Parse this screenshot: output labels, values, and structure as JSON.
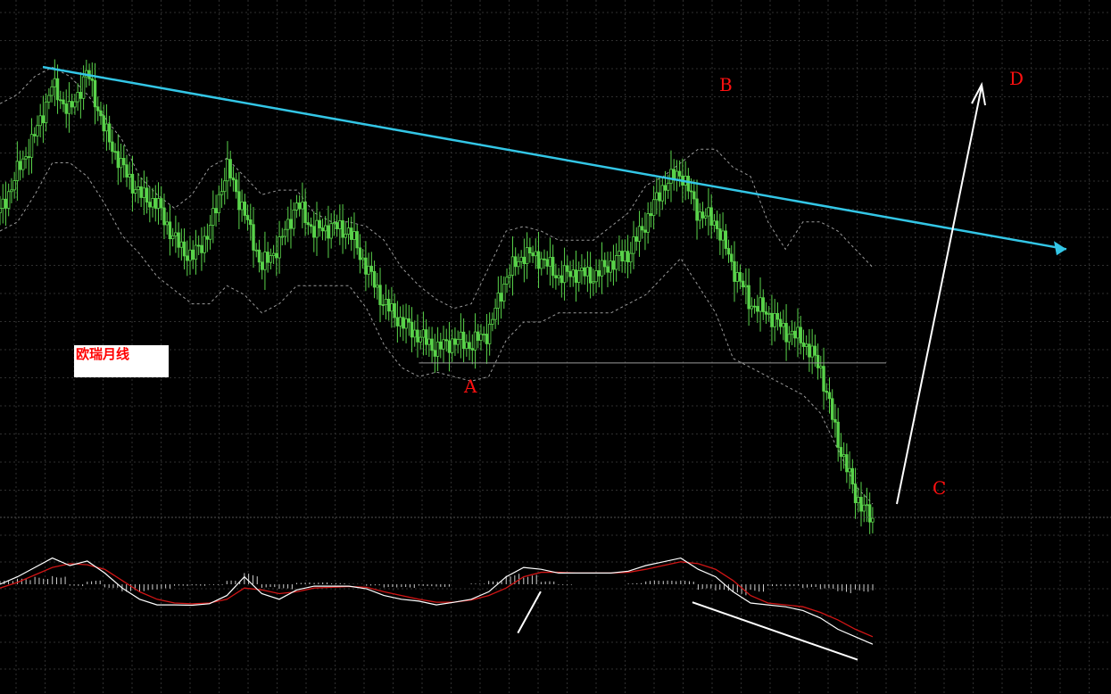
{
  "page_label": "欧瑞月线",
  "wave_points": {
    "A": "A",
    "B": "B",
    "C": "C",
    "D": "D"
  },
  "colors": {
    "background": "#000000",
    "grid": "#2f2f2f",
    "candle": "#59d24a",
    "bands": "#9a9a9a",
    "trendline": "#33c6e6",
    "support": "#9a9a9a",
    "projection_arrow": "#ffffff",
    "macd_fast": "#ffffff",
    "macd_signal": "#d01515",
    "histogram": "#cfcfcf",
    "divergence_lines": "#ffffff",
    "wave_labels": "#ff1010"
  },
  "chart_data": [
    {
      "type": "line",
      "name": "price-panel",
      "title": "欧瑞月线",
      "series_kind": "monthly candlesticks with envelope bands",
      "ylim": [
        0,
        100
      ],
      "x": [
        0,
        2,
        4,
        6,
        8,
        10,
        12,
        14,
        16,
        18,
        20,
        22,
        24,
        26,
        28,
        30,
        32,
        34,
        36,
        38,
        40,
        42,
        44,
        46,
        48,
        50,
        52,
        54,
        56,
        58,
        60,
        62,
        64,
        66,
        68,
        70,
        72,
        74,
        76,
        78,
        80,
        82,
        84,
        86,
        88,
        90,
        92,
        94,
        96,
        98,
        100
      ],
      "close": [
        64,
        73,
        81,
        92,
        86,
        95,
        82,
        74,
        68,
        66,
        58,
        54,
        60,
        74,
        64,
        52,
        57,
        66,
        60,
        61,
        60,
        52,
        44,
        40,
        37,
        34,
        36,
        35,
        38,
        50,
        55,
        54,
        50,
        51,
        50,
        53,
        55,
        62,
        70,
        73,
        64,
        62,
        52,
        44,
        42,
        38,
        36,
        30,
        14,
        2,
        -4
      ],
      "band_upper": [
        88,
        90,
        94,
        96,
        94,
        90,
        85,
        80,
        72,
        68,
        65,
        68,
        74,
        76,
        72,
        68,
        69,
        69,
        64,
        62,
        62,
        61,
        58,
        52,
        48,
        45,
        43,
        44,
        52,
        60,
        61,
        60,
        58,
        58,
        58,
        61,
        64,
        70,
        72,
        75,
        78,
        78,
        74,
        72,
        62,
        56,
        62,
        62,
        60,
        56,
        52
      ],
      "band_lower": [
        60,
        62,
        68,
        75,
        75,
        72,
        66,
        59,
        55,
        50,
        47,
        44,
        44,
        48,
        46,
        42,
        44,
        48,
        48,
        48,
        48,
        43,
        35,
        30,
        28,
        29,
        28,
        27,
        28,
        36,
        40,
        40,
        42,
        42,
        42,
        42,
        44,
        46,
        50,
        54,
        48,
        42,
        32,
        30,
        28,
        26,
        24,
        20,
        12,
        4,
        0
      ],
      "support_level": 31,
      "trendline": {
        "x": [
          0,
          100
        ],
        "y": [
          99,
          57
        ]
      }
    },
    {
      "type": "line",
      "name": "macd-panel",
      "ylim": [
        -100,
        100
      ],
      "x": [
        0,
        2,
        4,
        6,
        8,
        10,
        12,
        14,
        16,
        18,
        20,
        22,
        24,
        26,
        28,
        30,
        32,
        34,
        36,
        38,
        40,
        42,
        44,
        46,
        48,
        50,
        52,
        54,
        56,
        58,
        60,
        62,
        64,
        66,
        68,
        70,
        72,
        74,
        76,
        78,
        80,
        82,
        84,
        86,
        88,
        90,
        92,
        94,
        96,
        98,
        100
      ],
      "series": [
        {
          "values": [
            0,
            20,
            45,
            70,
            50,
            62,
            30,
            -10,
            -40,
            -55,
            -55,
            -56,
            -52,
            -30,
            20,
            -25,
            -40,
            -15,
            -5,
            -5,
            -5,
            -12,
            -30,
            -40,
            -45,
            -55,
            -48,
            -40,
            -20,
            20,
            45,
            40,
            30,
            30,
            30,
            30,
            35,
            50,
            60,
            70,
            40,
            20,
            -20,
            -50,
            -55,
            -60,
            -70,
            -90,
            -120,
            -140,
            -160
          ]
        },
        {
          "values": [
            -10,
            5,
            25,
            45,
            55,
            52,
            40,
            10,
            -20,
            -40,
            -50,
            -52,
            -50,
            -40,
            -10,
            -15,
            -25,
            -20,
            -10,
            -8,
            -6,
            -8,
            -20,
            -30,
            -40,
            -48,
            -48,
            -42,
            -30,
            -10,
            20,
            32,
            32,
            30,
            30,
            30,
            32,
            40,
            50,
            60,
            55,
            40,
            10,
            -30,
            -50,
            -55,
            -60,
            -75,
            -95,
            -120,
            -140
          ]
        }
      ],
      "histogram": [
        10,
        15,
        20,
        25,
        -5,
        10,
        -10,
        -20,
        -20,
        -15,
        -5,
        -4,
        -2,
        10,
        30,
        -10,
        -15,
        5,
        5,
        3,
        1,
        -4,
        -10,
        -10,
        -5,
        -7,
        0,
        2,
        10,
        30,
        25,
        8,
        -2,
        0,
        0,
        0,
        3,
        10,
        10,
        10,
        -15,
        -20,
        -30,
        -20,
        -5,
        -5,
        -10,
        -15,
        -25,
        -20,
        -20
      ],
      "divergence_lines": [
        {
          "x": [
            44,
            64
          ],
          "y": [
            -130,
            -48
          ]
        },
        {
          "x": [
            64,
            100
          ],
          "y": [
            -48,
            -230
          ]
        }
      ]
    }
  ]
}
